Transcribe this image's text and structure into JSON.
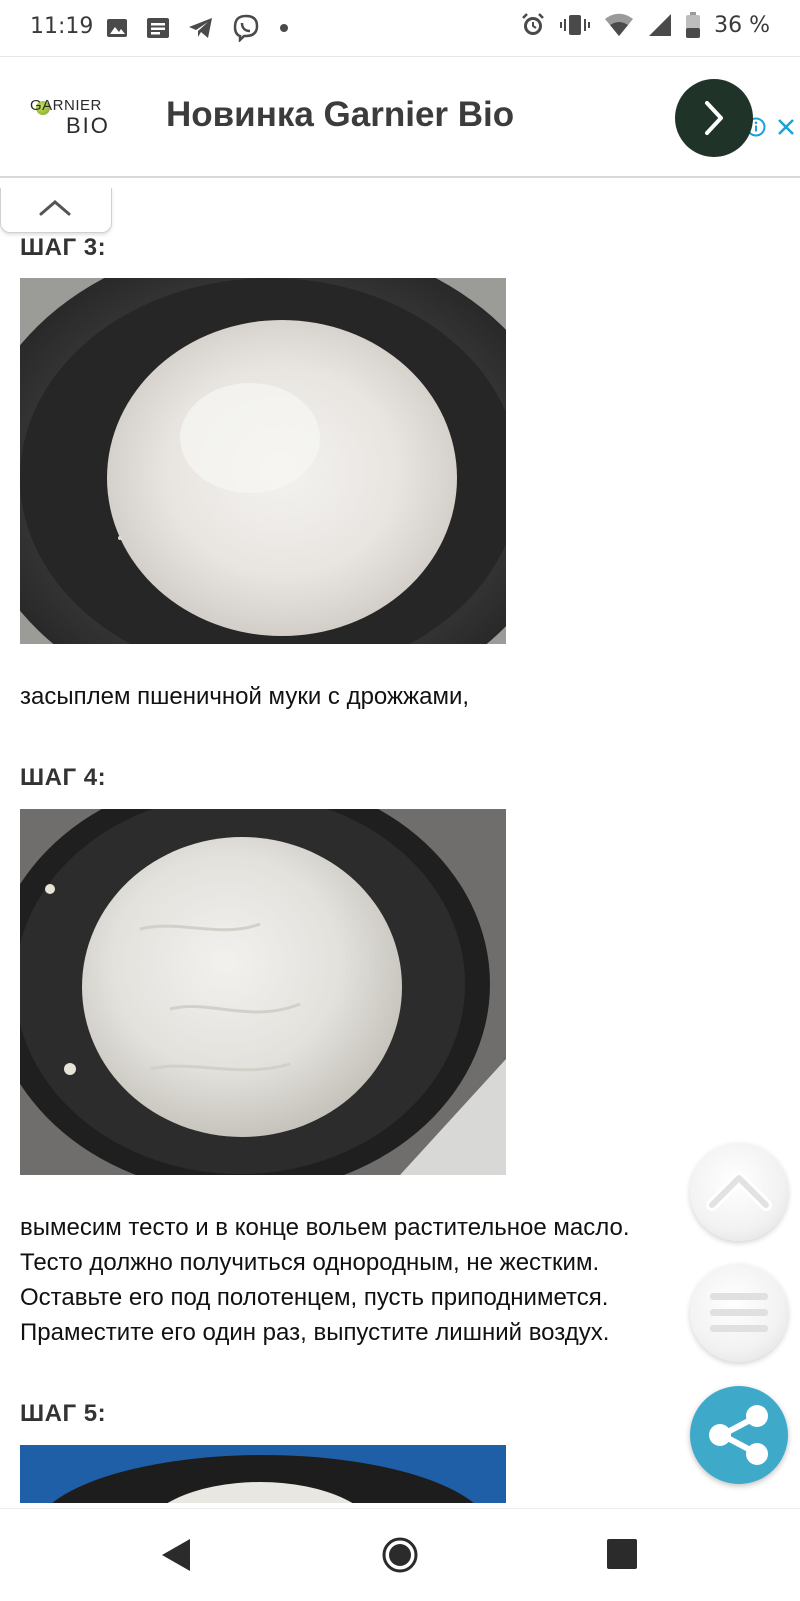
{
  "status_bar": {
    "time": "11:19",
    "battery_percent": "36 %",
    "left_icons": [
      "gallery-icon",
      "news-icon",
      "telegram-icon",
      "viber-icon",
      "dot-icon"
    ],
    "right_icons": [
      "alarm-icon",
      "vibrate-icon",
      "wifi-icon",
      "signal-icon",
      "battery-icon"
    ]
  },
  "ad": {
    "logo_top": "GARNIER",
    "logo_bottom": "BIO",
    "headline": "Новинка Garnier Bio",
    "cta_icon": "chevron-right-icon",
    "colors": {
      "cta": "#1f3329"
    }
  },
  "steps": [
    {
      "title": "ШАГ 3:",
      "text": "засыплем пшеничной муки с дрожжами,"
    },
    {
      "title": "ШАГ 4:",
      "lines": [
        "вымесим тесто и в конце вольем растительное масло.",
        "Тесто должно получиться однородным, не жестким.",
        "Оставьте его под полотенцем, пусть приподнимется.",
        "Праместите его один раз, выпустите лишний воздух."
      ]
    },
    {
      "title": "ШАГ 5:"
    }
  ],
  "fabs": {
    "up_icon": "arrow-up-icon",
    "menu_icon": "menu-icon",
    "share_icon": "share-icon",
    "colors": {
      "share": "#3fa9c9"
    }
  },
  "navbar": {
    "icons": [
      "back-icon",
      "home-icon",
      "recents-icon"
    ]
  }
}
